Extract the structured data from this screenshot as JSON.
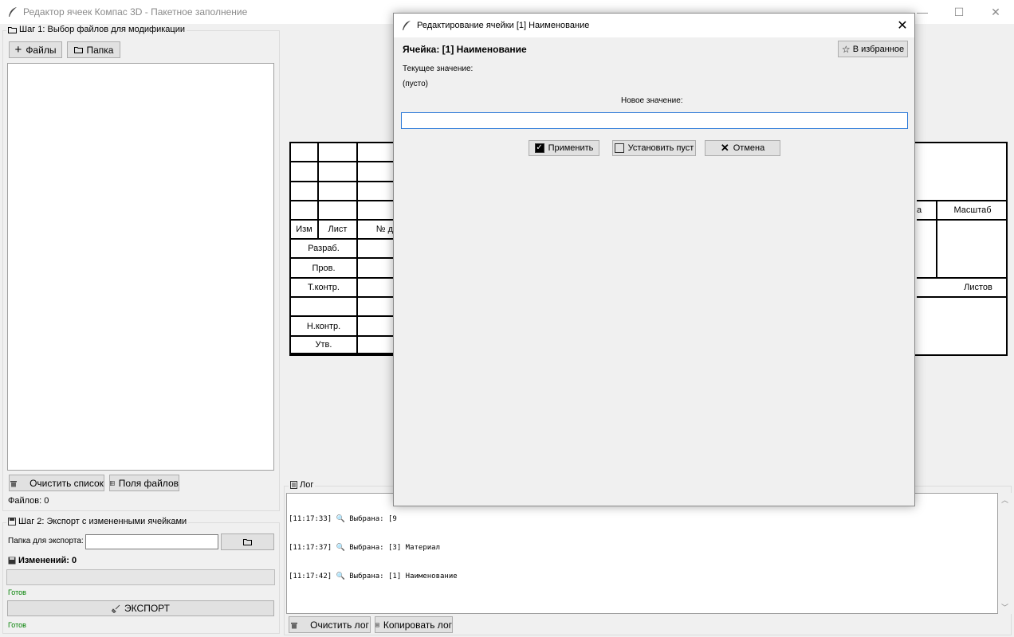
{
  "window": {
    "title": "Редактор ячеек Компас 3D - Пакетное заполнение",
    "minimize": "—",
    "maximize": "☐",
    "close": "✕"
  },
  "step1": {
    "title": "Шаг 1: Выбор файлов для модификации",
    "files_button": "Файлы",
    "folder_button": "Папка",
    "clear_list_button": "Очистить список",
    "file_fields_button": "Поля файлов",
    "files_count": "Файлов: 0"
  },
  "step2": {
    "title": "Шаг 2: Экспорт с измененными ячейками",
    "export_folder_label": "Папка для экспорта:",
    "export_folder_value": "",
    "changes_label": "Изменений: 0",
    "status_top": "Готов",
    "export_button": "ЭКСПОРТ",
    "status_bottom": "Готов"
  },
  "stamp": {
    "izm": "Изм",
    "list": "Лист",
    "ndoc": "№ д",
    "razrab": "Разраб.",
    "prov": "Пров.",
    "tkontr": "Т.контр.",
    "nkontr": "Н.контр.",
    "utv": "Утв.",
    "masshtab": "Масштаб",
    "listov": "Листов",
    "massa_partial": "а"
  },
  "log": {
    "title": "Лог",
    "lines": [
      "[11:17:33] 🔍 Выбрана: [9",
      "[11:17:37] 🔍 Выбрана: [3] Материал",
      "[11:17:42] 🔍 Выбрана: [1] Наименование"
    ],
    "clear_button": "Очистить лог",
    "copy_button": "Копировать лог"
  },
  "dialog": {
    "title": "Редактирование ячейки [1] Наименование",
    "cell_heading": "Ячейка: [1] Наименование",
    "favorite_button": "В избранное",
    "current_label": "Текущее значение:",
    "current_value": "(пусто)",
    "new_label": "Новое значение:",
    "new_value": "",
    "apply_button": "Применить",
    "set_empty_button": "Установить пуст",
    "cancel_button": "Отмена"
  },
  "colors": {
    "status_green": "#008000",
    "focus_blue": "#2b79d8"
  }
}
